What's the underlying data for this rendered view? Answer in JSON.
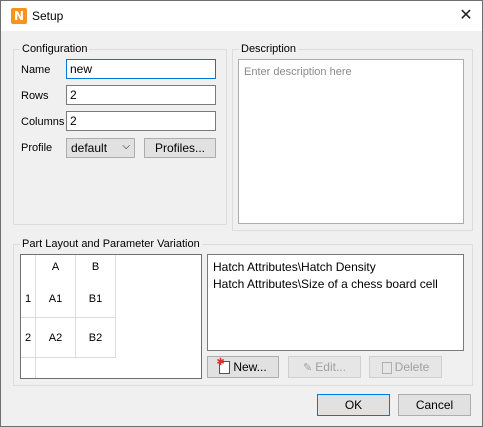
{
  "window": {
    "title": "Setup",
    "app_icon_letter": "N",
    "close_glyph": "✕"
  },
  "configuration": {
    "group_title": "Configuration",
    "name_label": "Name",
    "name_value": "new",
    "rows_label": "Rows",
    "rows_value": "2",
    "columns_label": "Columns",
    "columns_value": "2",
    "profile_label": "Profile",
    "profile_value": "default",
    "profiles_button": "Profiles..."
  },
  "description": {
    "group_title": "Description",
    "placeholder": "Enter description here"
  },
  "part_layout": {
    "group_title": "Part Layout and Parameter Variation",
    "column_headers": [
      "A",
      "B"
    ],
    "row_headers": [
      "1",
      "2"
    ],
    "cells": [
      [
        "A1",
        "B1"
      ],
      [
        "A2",
        "B2"
      ]
    ],
    "parameters": [
      "Hatch Attributes\\Hatch Density",
      "Hatch Attributes\\Size of a chess board cell"
    ],
    "new_button": "New...",
    "edit_button": "Edit...",
    "delete_button": "Delete"
  },
  "footer": {
    "ok": "OK",
    "cancel": "Cancel"
  },
  "colors": {
    "accent": "#0078d7",
    "app_icon": "#f7931e"
  }
}
